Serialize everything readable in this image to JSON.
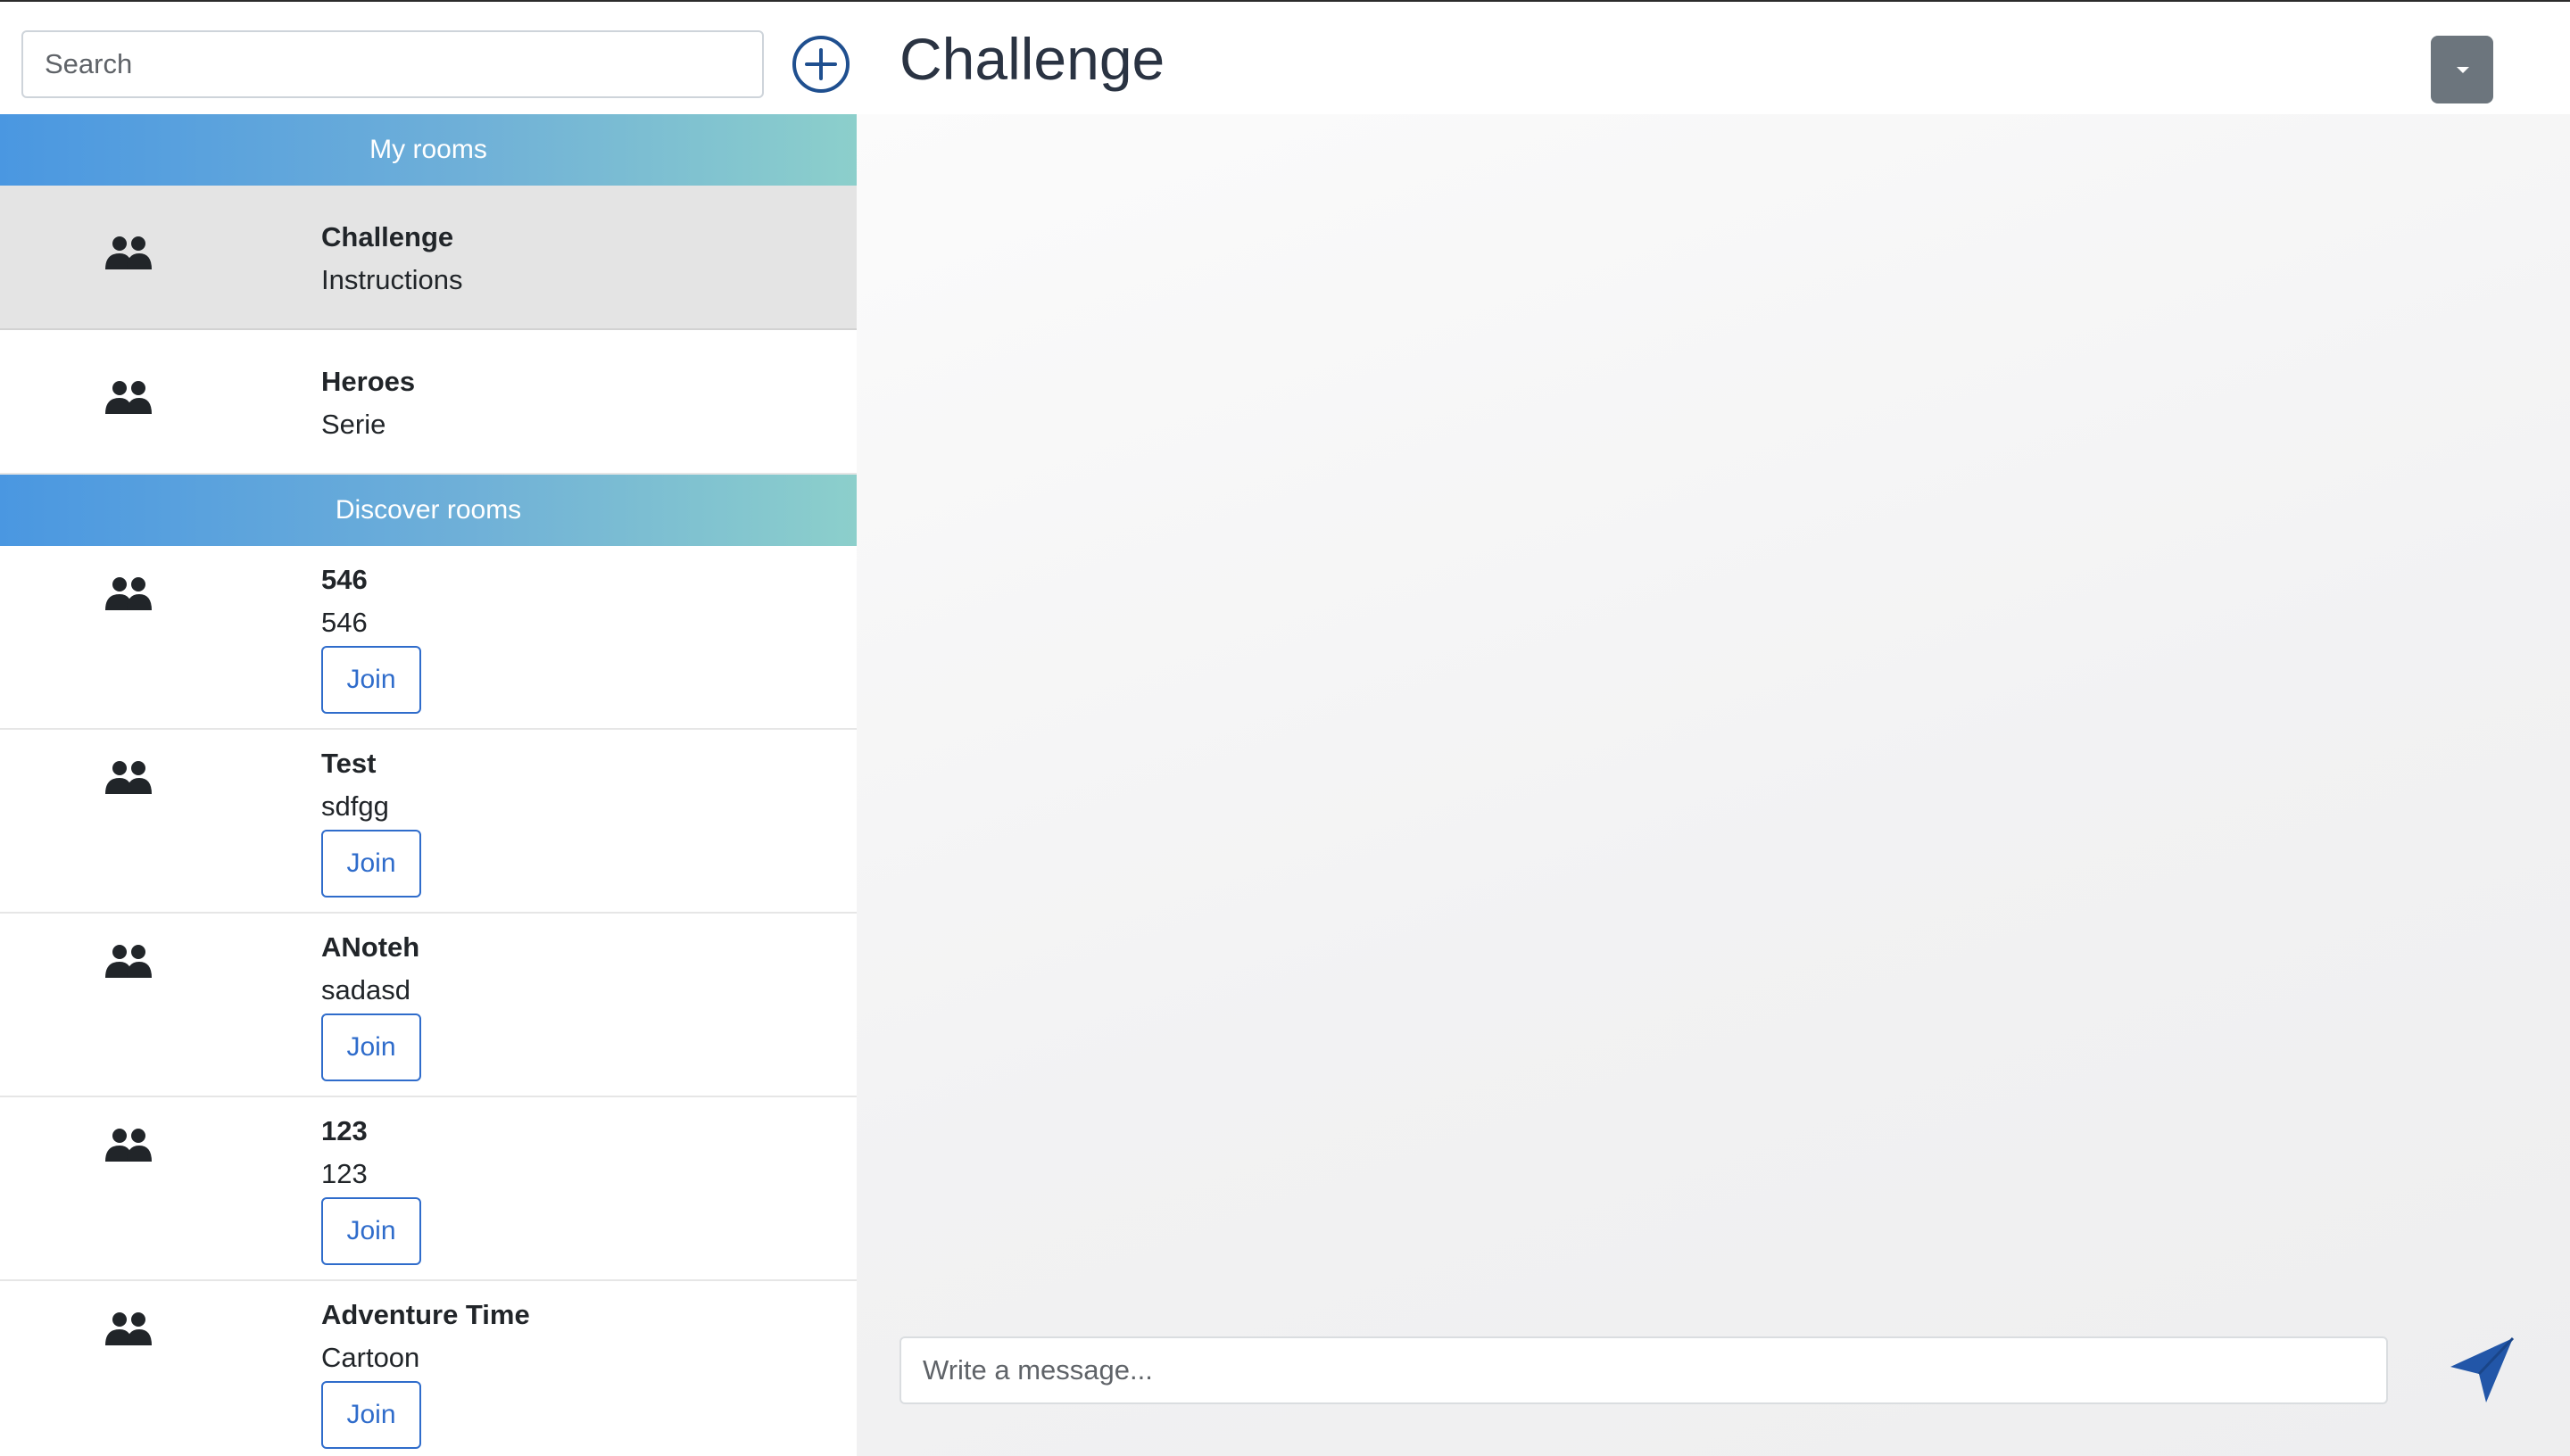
{
  "sidebar": {
    "search_placeholder": "Search",
    "add_room_icon": "plus-circle-icon",
    "my_rooms_header": "My rooms",
    "discover_header": "Discover rooms",
    "my_rooms": [
      {
        "name": "Challenge",
        "description": "Instructions",
        "active": true
      },
      {
        "name": "Heroes",
        "description": "Serie",
        "active": false
      }
    ],
    "discover_rooms": [
      {
        "name": "546",
        "description": "546",
        "join_label": "Join"
      },
      {
        "name": "Test",
        "description": "sdfgg",
        "join_label": "Join"
      },
      {
        "name": "ANoteh",
        "description": "sadasd",
        "join_label": "Join"
      },
      {
        "name": "123",
        "description": "123",
        "join_label": "Join"
      },
      {
        "name": "Adventure Time",
        "description": "Cartoon",
        "join_label": "Join"
      }
    ],
    "room_icon": "users-icon"
  },
  "main": {
    "title": "Challenge",
    "dropdown_icon": "caret-down-icon",
    "message_placeholder": "Write a message...",
    "send_icon": "paper-plane-icon"
  },
  "colors": {
    "accent_blue": "#2f6ccb",
    "header_gradient_start": "#4a97e1",
    "header_gradient_end": "#8ccfcb",
    "dropdown_gray": "#6c757d",
    "active_room_bg": "#e4e4e4"
  }
}
